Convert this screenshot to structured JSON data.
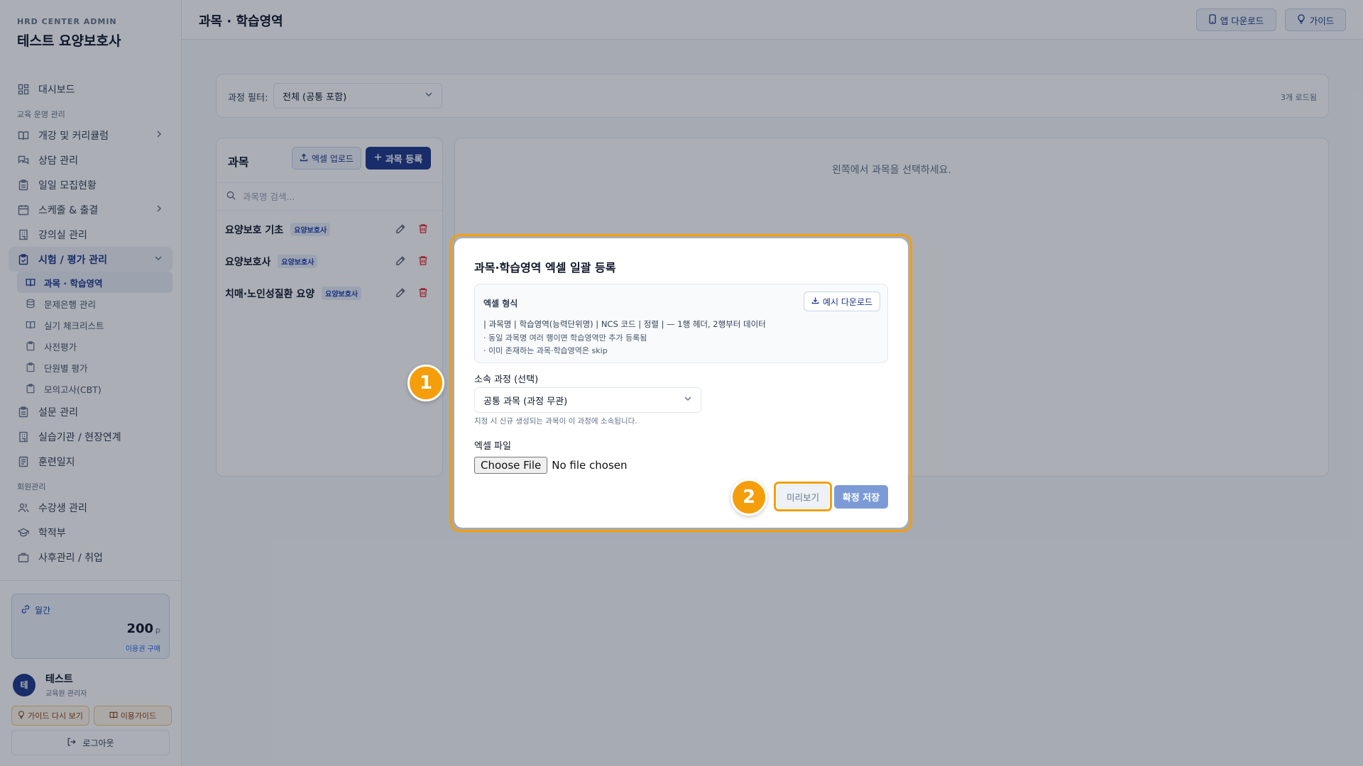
{
  "brand": {
    "top": "HRD CENTER ADMIN",
    "name": "테스트 요양보호사"
  },
  "sidebar": {
    "dashboard": "대시보드",
    "section_edu": "교육 운영 관리",
    "items_a": [
      "개강 및 커리큘럼",
      "상담 관리",
      "일일 모집현황",
      "스케줄 & 출결",
      "강의실 관리"
    ],
    "exam": "시험 / 평가 관리",
    "sub_items": [
      "과목 · 학습영역",
      "문제은행 관리",
      "실기 체크리스트",
      "사전평가",
      "단원별 평가",
      "모의고사(CBT)"
    ],
    "items_b": [
      "설문 관리",
      "실습기관 / 현장연계",
      "훈련일지"
    ],
    "section_members": "회원관리",
    "items_c": [
      "수강생 관리",
      "학적부",
      "사후관리 / 취업"
    ]
  },
  "points": {
    "label": "월간",
    "value": "200",
    "unit": "p",
    "buy": "이용권 구매"
  },
  "user": {
    "initial": "테",
    "name": "테스트",
    "role": "교육원 관리자"
  },
  "footer_buttons": {
    "guide_again": "가이드 다시 보기",
    "usage_guide": "이용가이드",
    "logout": "로그아웃"
  },
  "topbar": {
    "title": "과목 · 학습영역",
    "app_download": "앱 다운로드",
    "guide": "가이드"
  },
  "filter": {
    "label": "과정 필터:",
    "value": "전체 (공통 포함)",
    "loaded": "3개 로드됨"
  },
  "subjects": {
    "header": "과목",
    "excel_upload": "엑셀 업로드",
    "add": "과목 등록",
    "search_placeholder": "과목명 검색...",
    "rows": [
      {
        "name": "요양보호 기초",
        "tag": "요양보호사"
      },
      {
        "name": "요양보호사",
        "tag": "요양보호사"
      },
      {
        "name": "치매·노인성질환 요양",
        "tag": "요양보호사"
      }
    ]
  },
  "detail": {
    "empty": "왼쪽에서 과목을 선택하세요."
  },
  "modal": {
    "title": "과목·학습영역 엑셀 일괄 등록",
    "format_label": "엑셀 형식",
    "download_sample": "예시 다운로드",
    "format_line": "| 과목명 | 학습영역(능력단위명) | NCS 코드 | 정렬 | — 1행 헤더, 2행부터 데이터",
    "note1": "· 동일 과목명 여러 행이면 학습영역만 추가 등록됨",
    "note2": "· 이미 존재하는 과목·학습영역은 skip",
    "course_label": "소속 과정 (선택)",
    "course_value": "공통 과목 (과정 무관)",
    "course_hint": "지정 시 신규 생성되는 과목이 이 과정에 소속됩니다.",
    "file_label": "엑셀 파일",
    "choose_file": "Choose File",
    "no_file": "No file chosen",
    "preview": "미리보기",
    "save": "확정 저장"
  },
  "markers": [
    "1",
    "2"
  ],
  "colors": {
    "primary": "#1e3a8a",
    "accent": "#f59e0b",
    "danger": "#dc2626"
  }
}
